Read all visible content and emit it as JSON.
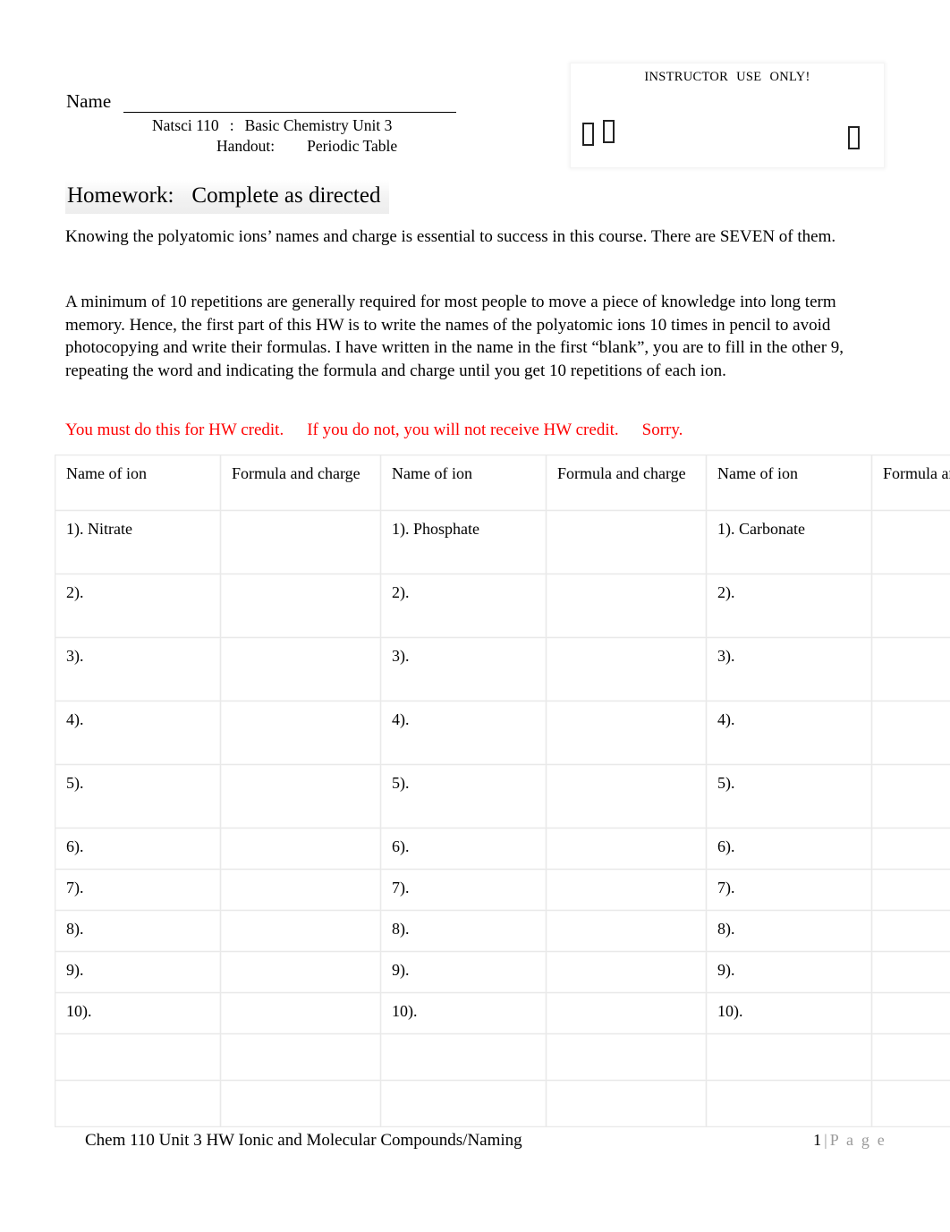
{
  "header": {
    "name_label": "Name",
    "name_value": "",
    "course": "Natsci 110",
    "course_separator": ":",
    "course_title": "Basic Chemistry Unit 3",
    "handout_label": "Handout:",
    "handout_value": "Periodic Table"
  },
  "instructor_box": {
    "title_part1": "INSTRUCTOR",
    "title_part2": "USE",
    "title_part3": "ONLY!",
    "glyph_1": "missing-glyph-box",
    "glyph_2": "missing-glyph-box",
    "glyph_3": "missing-glyph-box"
  },
  "homework": {
    "label": "Homework:",
    "value": "Complete as directed"
  },
  "body": {
    "paragraph_1": "Knowing the polyatomic ions’ names and charge is essential to success in this course.   There are SEVEN of them.",
    "paragraph_2": "A minimum of 10 repetitions are generally required for most people to move a piece of knowledge into long term memory.  Hence, the first part of this HW is to write the names of the polyatomic ions 10 times in pencil to avoid photocopying and write their formulas.  I have written in the name in the first “blank”, you are to fill in the other 9, repeating the word and indicating the formula and charge until you get 10 repetitions of each ion.",
    "warning_1": "You must do this for HW credit.",
    "warning_2": "If you do not, you will not receive HW credit.",
    "warning_3": "Sorry.",
    "warning_color": "#FF0000"
  },
  "table": {
    "headers": [
      "Name of ion",
      "Formula and charge",
      "Name of ion",
      "Formula and charge",
      "Name of ion",
      "Formula and charge"
    ],
    "rows": [
      {
        "height": "tall",
        "cells": [
          "1).  Nitrate",
          "",
          "1).  Phosphate",
          "",
          "1).  Carbonate",
          ""
        ]
      },
      {
        "height": "tall",
        "cells": [
          "2).",
          "",
          "2).",
          "",
          "2).",
          ""
        ]
      },
      {
        "height": "tall",
        "cells": [
          "3).",
          "",
          "3).",
          "",
          "3).",
          ""
        ]
      },
      {
        "height": "tall",
        "cells": [
          "4).",
          "",
          "4).",
          "",
          "4).",
          ""
        ]
      },
      {
        "height": "tall",
        "cells": [
          "5).",
          "",
          "5).",
          "",
          "5).",
          ""
        ]
      },
      {
        "height": "short",
        "cells": [
          "6).",
          "",
          "6).",
          "",
          "6).",
          ""
        ]
      },
      {
        "height": "short",
        "cells": [
          "7).",
          "",
          "7).",
          "",
          "7).",
          ""
        ]
      },
      {
        "height": "short",
        "cells": [
          "8).",
          "",
          "8).",
          "",
          "8).",
          ""
        ]
      },
      {
        "height": "short",
        "cells": [
          "9).",
          "",
          "9).",
          "",
          "9).",
          ""
        ]
      },
      {
        "height": "short",
        "cells": [
          "10).",
          "",
          "10).",
          "",
          "10).",
          ""
        ]
      },
      {
        "height": "blank",
        "cells": [
          "",
          "",
          "",
          "",
          "",
          ""
        ]
      },
      {
        "height": "blank",
        "cells": [
          "",
          "",
          "",
          "",
          "",
          ""
        ]
      }
    ]
  },
  "footer": {
    "left": "Chem 110 Unit 3 HW Ionic and Molecular Compounds/Naming",
    "page_number": "1",
    "page_separator": "|",
    "page_word": "P a g e"
  }
}
